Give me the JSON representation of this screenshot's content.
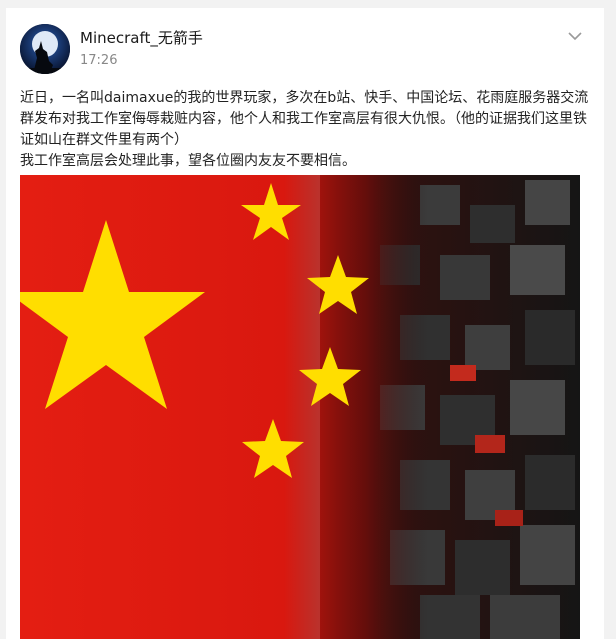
{
  "post": {
    "username": "Minecraft_无箭手",
    "time": "17:26",
    "paragraph1": "近日，一名叫daimaxue的我的世界玩家，多次在b站、快手、中国论坛、花雨庭服务器交流群发布对我工作室侮辱栽赃内容，他个人和我工作室高层有很大仇恨。（他的证据我们这里铁证如山在群文件里有两个）",
    "paragraph2": "我工作室高层会处理此事，望各位圈内友友不要相信。"
  },
  "icons": {
    "avatar": "wolf-howling-moon-avatar",
    "menu": "chevron-down-icon"
  },
  "colors": {
    "flag_red": "#de2910",
    "flag_yellow": "#ffde00",
    "background": "#f2f2f2"
  }
}
